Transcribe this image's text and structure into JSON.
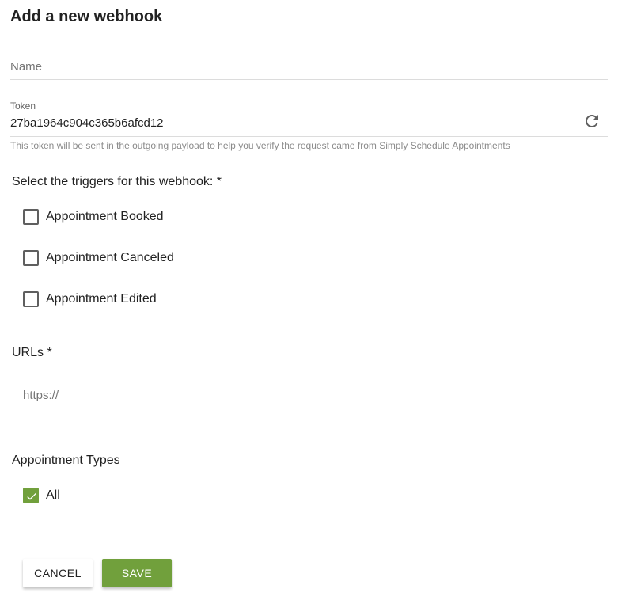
{
  "dialog": {
    "title": "Add a new webhook"
  },
  "name_field": {
    "placeholder": "Name",
    "value": ""
  },
  "token": {
    "label": "Token",
    "value": "27ba1964c904c365b6afcd12",
    "hint": "This token will be sent in the outgoing payload to help you verify the request came from Simply Schedule Appointments"
  },
  "triggers": {
    "label": "Select the triggers for this webhook: *",
    "items": [
      {
        "label": "Appointment Booked",
        "checked": false
      },
      {
        "label": "Appointment Canceled",
        "checked": false
      },
      {
        "label": "Appointment Edited",
        "checked": false
      }
    ]
  },
  "urls": {
    "label": "URLs *",
    "placeholder": "https://",
    "value": ""
  },
  "appointment_types": {
    "label": "Appointment Types",
    "items": [
      {
        "label": "All",
        "checked": true
      }
    ]
  },
  "actions": {
    "cancel_label": "CANCEL",
    "save_label": "SAVE"
  },
  "colors": {
    "accent": "#71a03c",
    "text": "#212121",
    "hint": "#8a8a8a"
  },
  "icons": {
    "refresh": "refresh-icon",
    "check": "checkmark-icon"
  }
}
